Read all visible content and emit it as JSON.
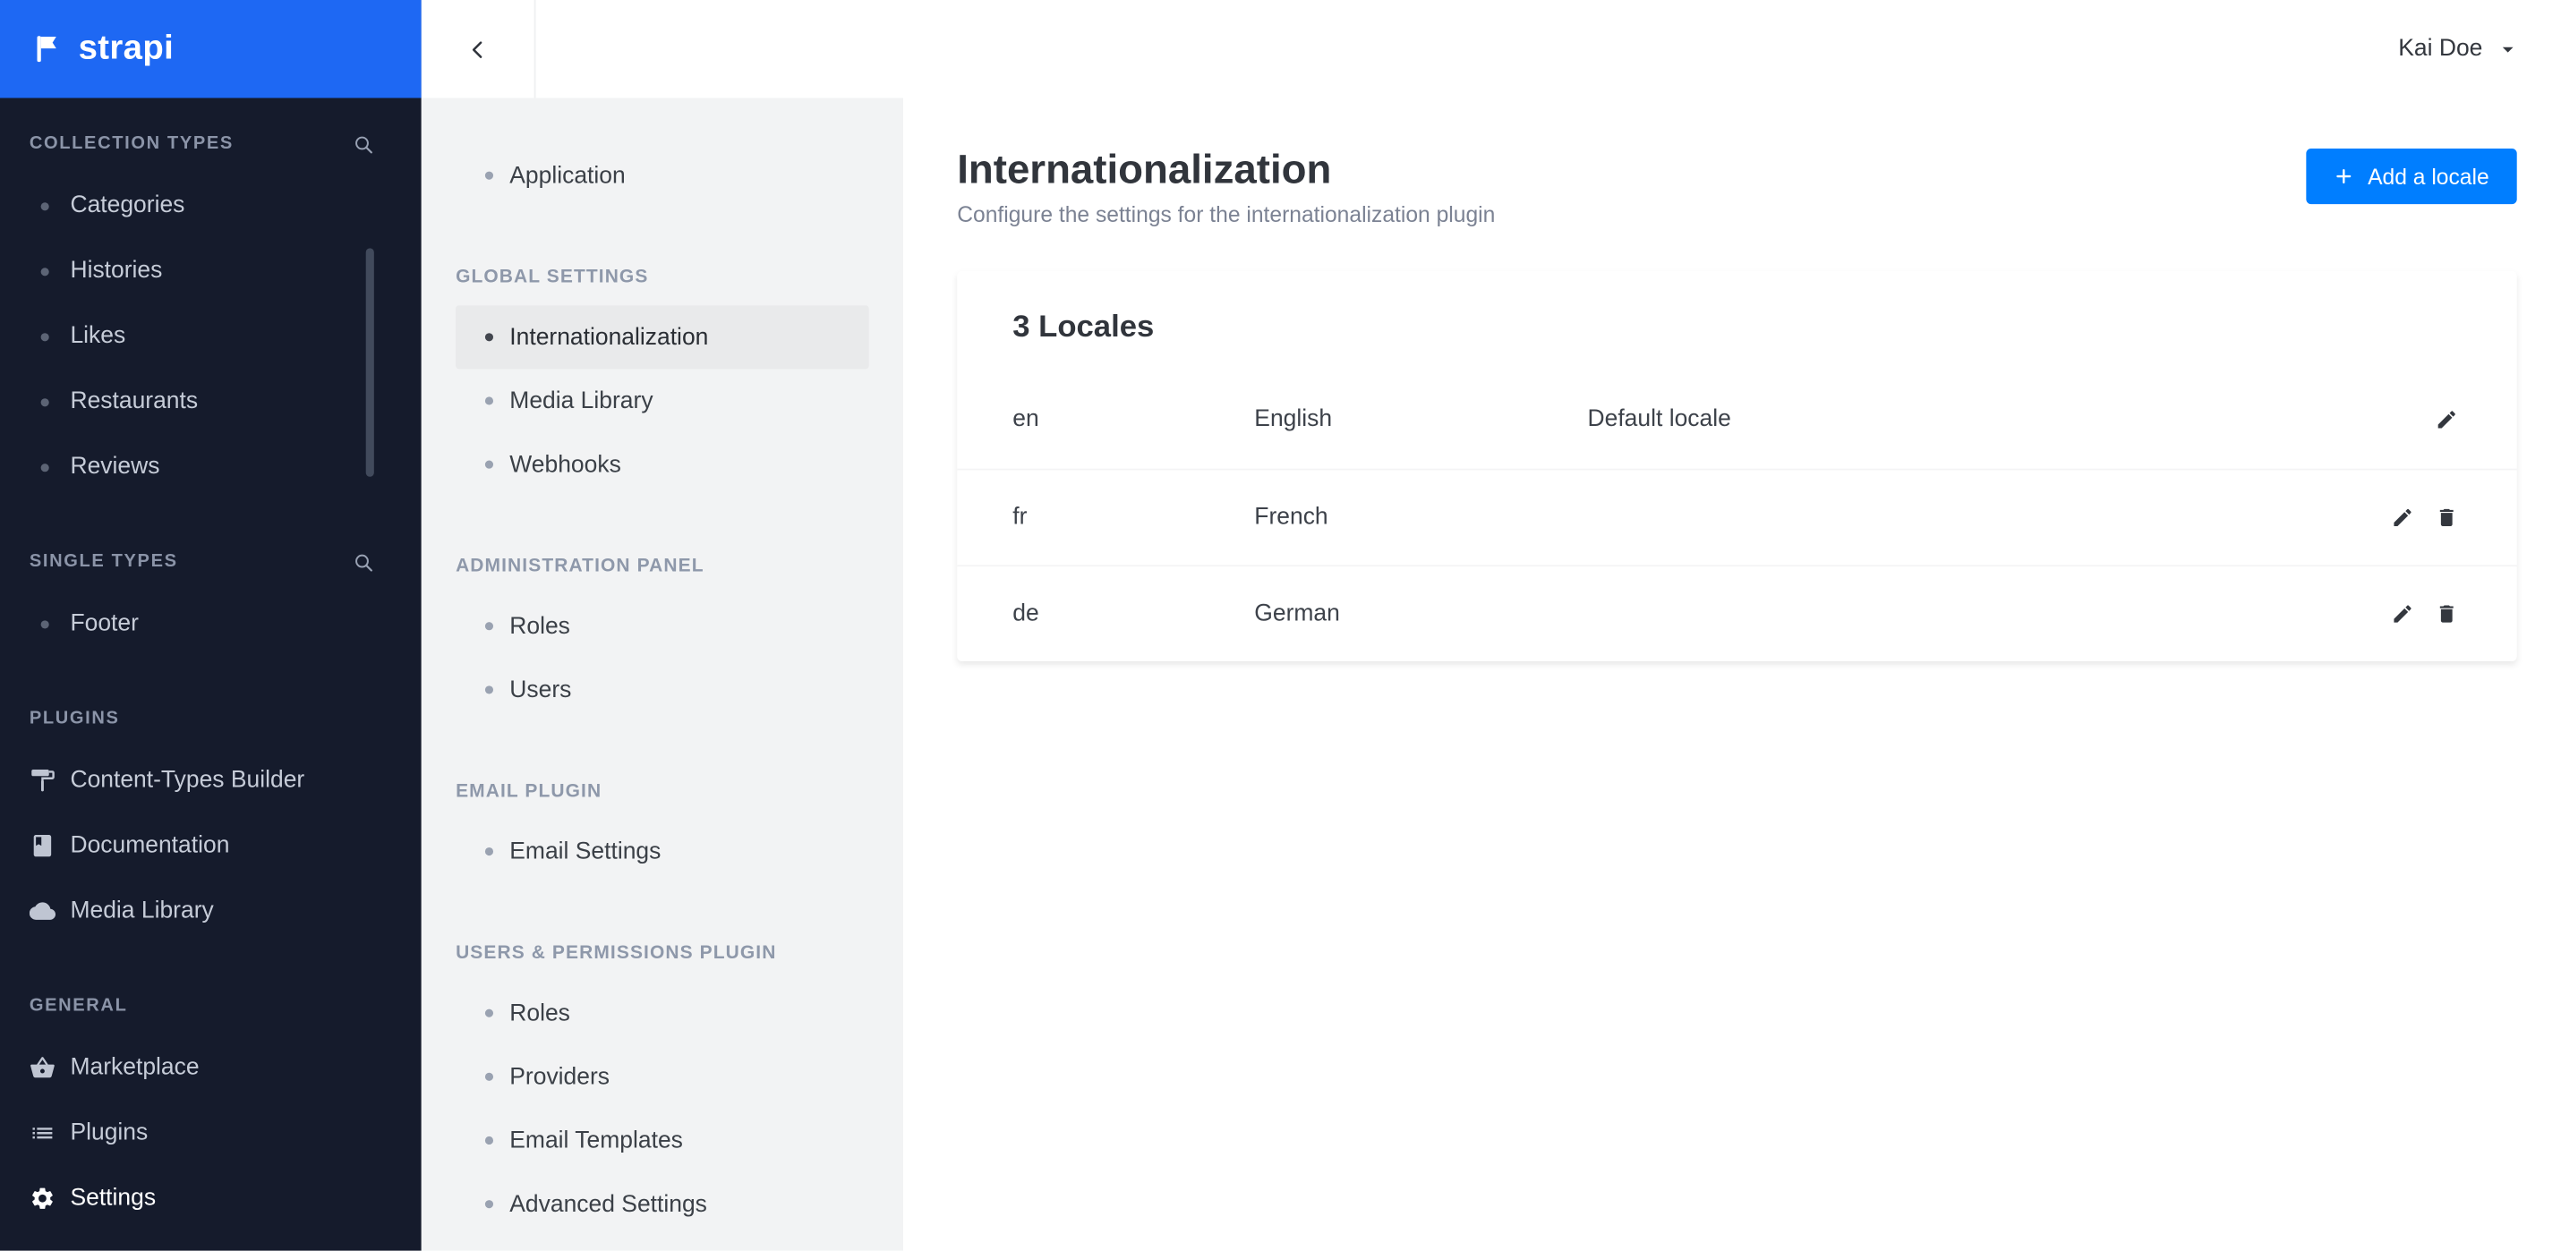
{
  "brand": {
    "name": "strapi"
  },
  "user": {
    "name": "Kai Doe"
  },
  "colors": {
    "brand_blue": "#007eff",
    "logo_blue": "#1e68f3",
    "sidebar_bg": "#151b2c",
    "subnav_bg": "#f2f3f4",
    "active_item_bg": "#e9eaeb"
  },
  "sidebar": {
    "sections": [
      {
        "label": "COLLECTION TYPES",
        "has_search": true,
        "items": [
          {
            "label": "Categories"
          },
          {
            "label": "Histories"
          },
          {
            "label": "Likes"
          },
          {
            "label": "Restaurants"
          },
          {
            "label": "Reviews"
          }
        ]
      },
      {
        "label": "SINGLE TYPES",
        "has_search": true,
        "items": [
          {
            "label": "Footer"
          }
        ]
      },
      {
        "label": "PLUGINS",
        "items": [
          {
            "label": "Content-Types Builder",
            "icon": "paint-roller-icon"
          },
          {
            "label": "Documentation",
            "icon": "book-icon"
          },
          {
            "label": "Media Library",
            "icon": "cloud-icon"
          }
        ]
      },
      {
        "label": "GENERAL",
        "items": [
          {
            "label": "Marketplace",
            "icon": "basket-icon"
          },
          {
            "label": "Plugins",
            "icon": "list-icon"
          },
          {
            "label": "Settings",
            "icon": "gear-icon",
            "active": true
          }
        ]
      }
    ]
  },
  "subnav": {
    "top_item": "Application",
    "sections": [
      {
        "label": "GLOBAL SETTINGS",
        "active": "Internationalization",
        "items": [
          "Internationalization",
          "Media Library",
          "Webhooks"
        ]
      },
      {
        "label": "ADMINISTRATION PANEL",
        "items": [
          "Roles",
          "Users"
        ]
      },
      {
        "label": "EMAIL PLUGIN",
        "items": [
          "Email Settings"
        ]
      },
      {
        "label": "USERS & PERMISSIONS PLUGIN",
        "items": [
          "Roles",
          "Providers",
          "Email Templates",
          "Advanced Settings"
        ]
      }
    ]
  },
  "main": {
    "title": "Internationalization",
    "subtitle": "Configure the settings for the internationalization plugin",
    "add_button": "Add a locale",
    "card": {
      "title": "3 Locales",
      "rows": [
        {
          "code": "en",
          "name": "English",
          "note": "Default locale",
          "actions": [
            "edit"
          ]
        },
        {
          "code": "fr",
          "name": "French",
          "note": "",
          "actions": [
            "edit",
            "delete"
          ]
        },
        {
          "code": "de",
          "name": "German",
          "note": "",
          "actions": [
            "edit",
            "delete"
          ]
        }
      ]
    }
  }
}
